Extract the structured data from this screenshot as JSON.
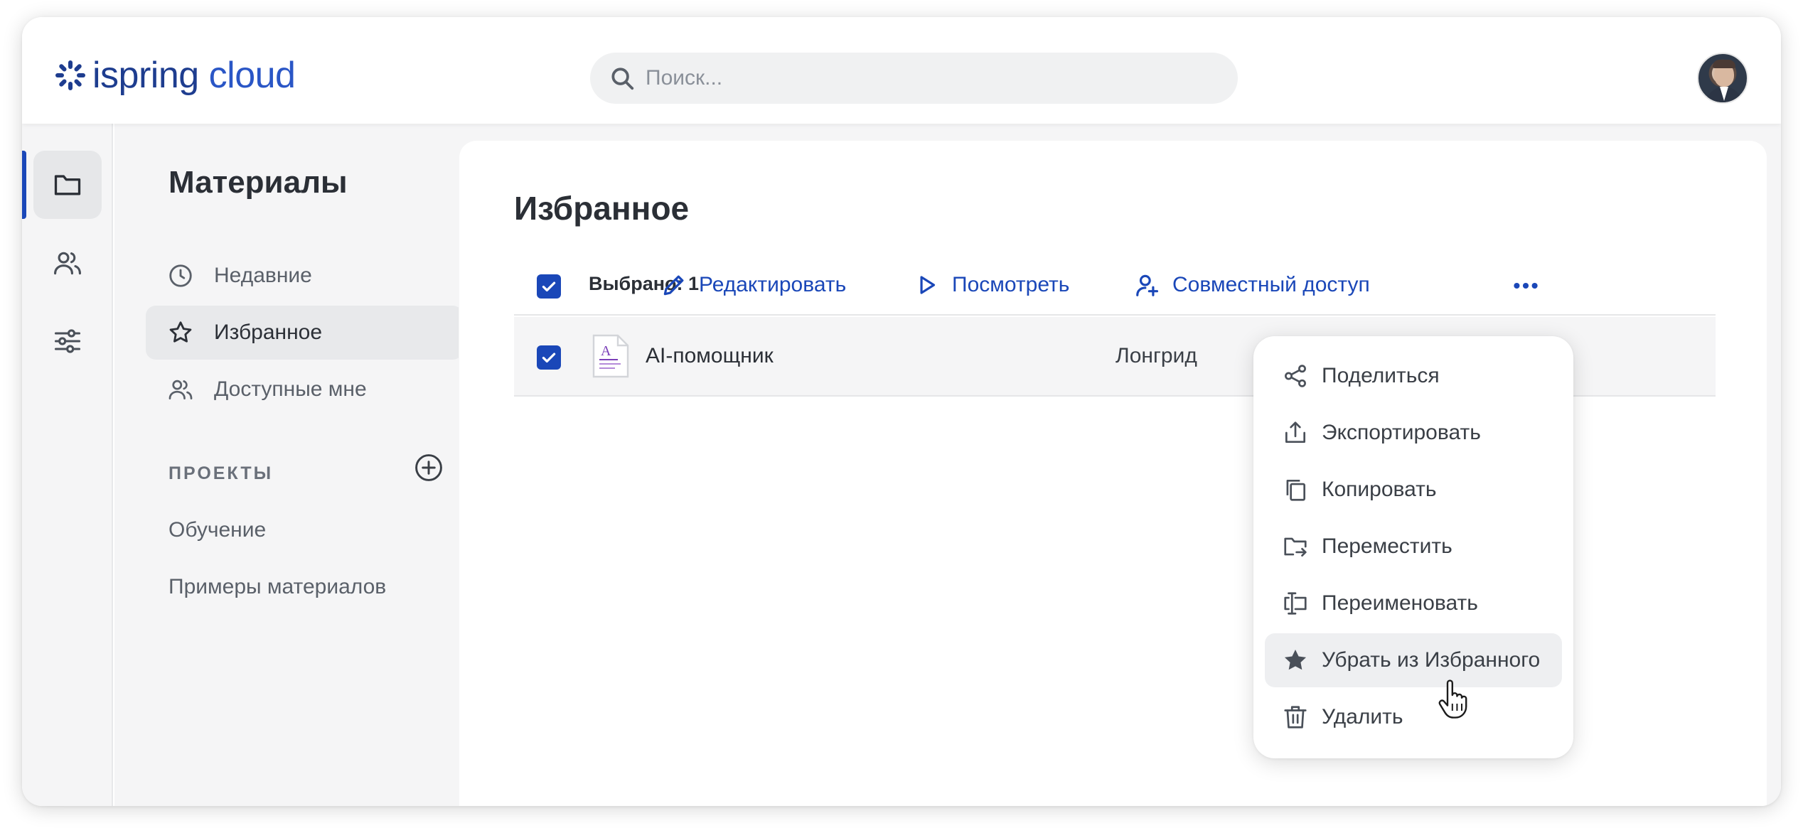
{
  "header": {
    "logo": {
      "part1": "ispring",
      "part2": "cloud"
    },
    "search_placeholder": "Поиск..."
  },
  "rail": {
    "items": [
      {
        "icon": "folder-icon",
        "active": true
      },
      {
        "icon": "users-icon",
        "active": false
      },
      {
        "icon": "sliders-icon",
        "active": false
      }
    ]
  },
  "sidebar": {
    "title": "Материалы",
    "items": [
      {
        "label": "Недавние",
        "icon": "clock-icon"
      },
      {
        "label": "Избранное",
        "icon": "star-icon",
        "active": true
      },
      {
        "label": "Доступные мне",
        "icon": "users-icon"
      }
    ],
    "projects_heading": "ПРОЕКТЫ",
    "projects": [
      "Обучение",
      "Примеры материалов"
    ]
  },
  "main": {
    "title": "Избранное",
    "toolbar": {
      "selected": "Выбрано: 1",
      "edit": "Редактировать",
      "view": "Посмотреть",
      "share_access": "Совместный доступ"
    },
    "rows": [
      {
        "name": "AI-помощник",
        "type": "Лонгрид",
        "checked": true
      }
    ]
  },
  "context_menu": {
    "items": [
      {
        "label": "Поделиться",
        "icon": "share-icon"
      },
      {
        "label": "Экспортировать",
        "icon": "export-icon"
      },
      {
        "label": "Копировать",
        "icon": "copy-icon"
      },
      {
        "label": "Переместить",
        "icon": "move-folder-icon"
      },
      {
        "label": "Переименовать",
        "icon": "rename-icon"
      },
      {
        "label": "Убрать из Избранного",
        "icon": "star-filled-icon",
        "hover": true
      },
      {
        "label": "Удалить",
        "icon": "trash-icon"
      }
    ]
  },
  "colors": {
    "accent": "#1a47b8",
    "sidebar_bg": "#f5f5f6",
    "text": "#2b2f36"
  }
}
